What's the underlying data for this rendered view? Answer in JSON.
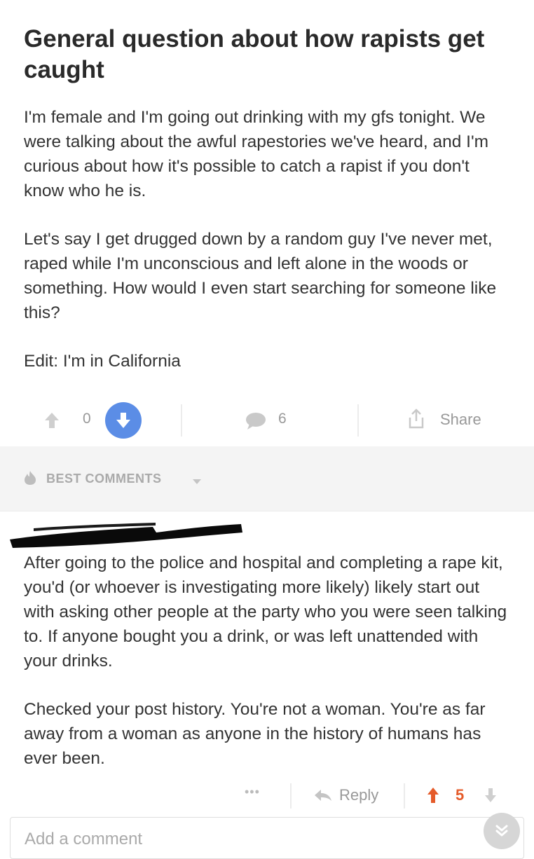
{
  "post": {
    "title": "General question about how rapists get caught",
    "paragraphs": [
      "I'm female and I'm going out drinking with my gfs tonight. We were talking about the awful rapestories we've heard, and I'm curious about how it's possible to catch a rapist if you don't know who he is.",
      "Let's say I get drugged down by a random guy I've never met, raped while I'm unconscious and left alone in the woods or something. How would I even start searching for someone like this?",
      "Edit: I'm in California"
    ],
    "score": "0",
    "comment_count": "6",
    "share_label": "Share"
  },
  "comments_header": {
    "label": "BEST COMMENTS"
  },
  "comment": {
    "paragraphs": [
      "After going to the police and hospital and completing a rape kit, you'd (or whoever is investigating more likely) likely start out with asking other people at the party who you were seen talking to. If anyone bought you a drink, or was left unattended with your drinks.",
      "Checked your post history. You're not a woman. You're as far away from a woman as anyone in the history of humans has ever been."
    ],
    "more_label": "•••",
    "reply_label": "Reply",
    "score": "5"
  },
  "composer": {
    "placeholder": "Add a comment"
  },
  "colors": {
    "downvote_active": "#5b8de6",
    "comment_upvote": "#e55b2a",
    "muted": "#999999"
  },
  "icons": [
    "upvote-icon",
    "downvote-icon",
    "comment-icon",
    "share-icon",
    "fire-icon",
    "caret-down-icon",
    "reply-icon",
    "scroll-down-icon"
  ]
}
